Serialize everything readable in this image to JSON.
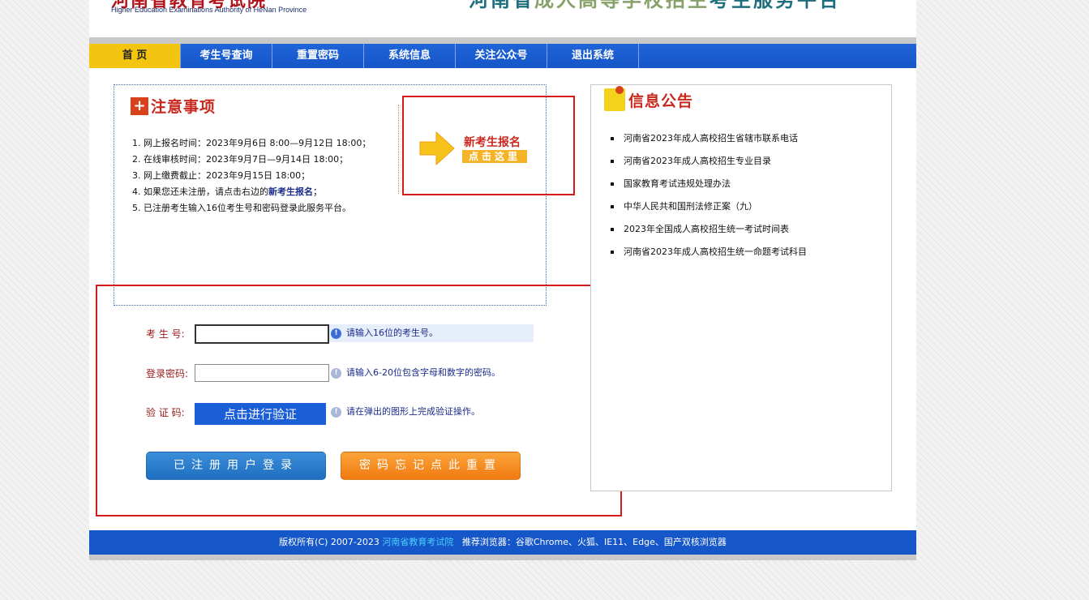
{
  "header": {
    "logo_cn": "河南省教育考试院",
    "logo_en": "Higher Education Examinations Authority of HeNan Province",
    "title_part1": "河南省",
    "title_part2": "成人高等学校招生",
    "title_part3": "考生服务平台"
  },
  "nav": [
    {
      "label": "首  页",
      "active": true
    },
    {
      "label": "考生号查询"
    },
    {
      "label": "重置密码"
    },
    {
      "label": "系统信息"
    },
    {
      "label": "关注公众号"
    },
    {
      "label": "退出系统"
    }
  ],
  "notice": {
    "title": "注意事项",
    "items": [
      "1. 网上报名时间：2023年9月6日 8:00—9月12日 18:00；",
      "2. 在线审核时间：2023年9月7日—9月14日 18:00；",
      "3. 网上缴费截止：2023年9月15日 18:00；",
      "4. 如果您还未注册，请点击右边的",
      "5. 已注册考生输入16位考生号和密码登录此服务平台。"
    ],
    "item4_highlight": "新考生报名",
    "item4_suffix": "；"
  },
  "register": {
    "label": "新考生报名",
    "click_here": "点击这里"
  },
  "login": {
    "exam_no_label": "考 生 号:",
    "exam_no_value": "",
    "exam_no_hint": "请输入16位的考生号。",
    "password_label": "登录密码:",
    "password_value": "",
    "password_hint": "请输入6-20位包含字母和数字的密码。",
    "verify_label": "验 证 码:",
    "verify_button": "点击进行验证",
    "verify_hint": "请在弹出的图形上完成验证操作。",
    "login_button": "已注册用户登录",
    "reset_button": "密码忘记点此重置"
  },
  "info": {
    "title": "信息公告",
    "items": [
      "河南省2023年成人高校招生省辖市联系电话",
      "河南省2023年成人高校招生专业目录",
      "国家教育考试违规处理办法",
      "中华人民共和国刑法修正案（九）",
      "2023年全国成人高校招生统一考试时间表",
      "河南省2023年成人高校招生统一命题考试科目"
    ]
  },
  "footer": {
    "copyright": "版权所有(C) 2007-2023 ",
    "org_link": "河南省教育考试院",
    "browsers": "   推荐浏览器：谷歌Chrome、火狐、IE11、Edge、国产双核浏览器"
  },
  "colors": {
    "nav_blue": "#1556c8",
    "nav_active": "#f3c410",
    "accent_red": "#c8281d",
    "highlight_box": "#d41c1c"
  }
}
